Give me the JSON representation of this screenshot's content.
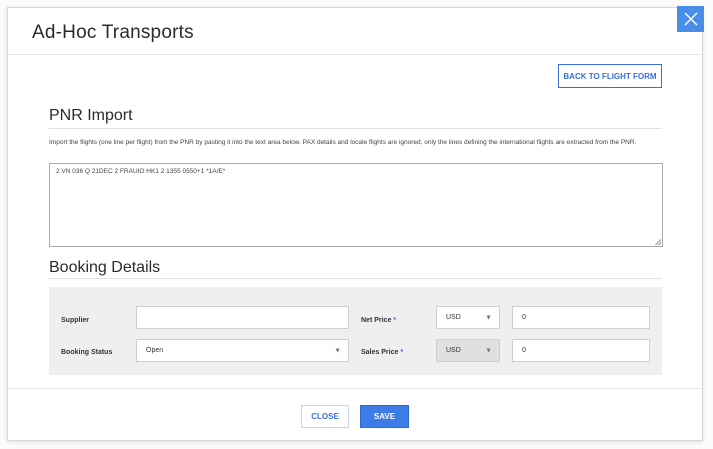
{
  "modal": {
    "title": "Ad-Hoc Transports",
    "back_button": "BACK TO FLIGHT FORM"
  },
  "pnr_import": {
    "heading": "PNR Import",
    "help_text": "Import the flights (one line per flight) from the PNR by pasting it into the text area below. PAX details and locale flights are ignored, only the lines defining the international flights are extracted from the PNR.",
    "value": "2 VN 036 Q 21DEC 2 FRAUIO HK1 2 1355 0550+1 *1A/E*"
  },
  "booking": {
    "heading": "Booking Details",
    "supplier": {
      "label": "Supplier",
      "value": ""
    },
    "booking_status": {
      "label": "Booking Status",
      "value": "Open"
    },
    "net_price": {
      "label": "Net Price",
      "currency": "USD",
      "value": "0"
    },
    "sales_price": {
      "label": "Sales Price",
      "currency": "USD",
      "value": "0"
    },
    "required_mark": "*"
  },
  "footer": {
    "close_label": "CLOSE",
    "save_label": "SAVE"
  },
  "icons": {
    "close": "close-icon",
    "dropdown": "chevron-down-icon"
  },
  "colors": {
    "accent": "#3c7ce6",
    "close_x_bg": "#4a8de8",
    "panel_bg": "#efefef"
  }
}
